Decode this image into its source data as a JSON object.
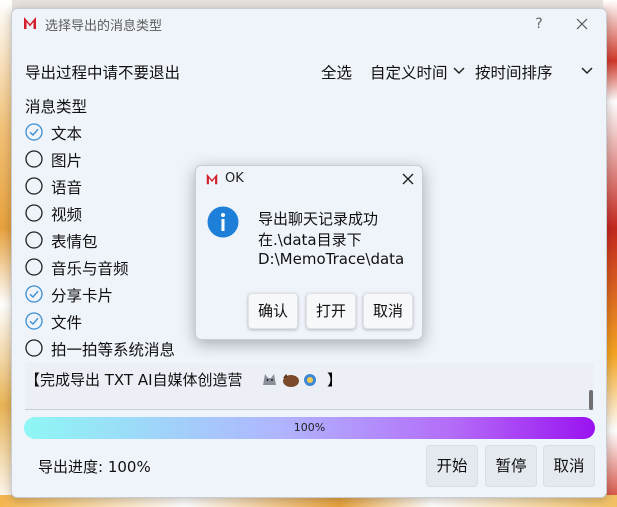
{
  "window": {
    "title": "选择导出的消息类型",
    "help_glyph": "?",
    "logo_letter": "M",
    "logo_color": "#d21f2a"
  },
  "header": {
    "notice": "导出过程中请不要退出",
    "select_all": "全选",
    "custom_time": "自定义时间",
    "sort_by_time": "按时间排序"
  },
  "message_types": {
    "label": "消息类型",
    "items": [
      {
        "label": "文本",
        "checked": true
      },
      {
        "label": "图片",
        "checked": false
      },
      {
        "label": "语音",
        "checked": false
      },
      {
        "label": "视频",
        "checked": false
      },
      {
        "label": "表情包",
        "checked": false
      },
      {
        "label": "音乐与音频",
        "checked": false
      },
      {
        "label": "分享卡片",
        "checked": true
      },
      {
        "label": "文件",
        "checked": true
      },
      {
        "label": "拍一拍等系统消息",
        "checked": false
      }
    ]
  },
  "log": {
    "text": "【完成导出 TXT AI自媒体创造营",
    "close_bracket": "】",
    "icons": [
      "wolf-emoji",
      "boar-emoji",
      "blowfish-emoji"
    ]
  },
  "progress": {
    "value": 1.0,
    "label": "100%"
  },
  "footer": {
    "status": "导出进度: 100%",
    "start_label": "开始",
    "pause_label": "暂停",
    "cancel_label": "取消"
  },
  "dialog": {
    "title": "OK",
    "message_lines": [
      "导出聊天记录成功",
      "在.\\data目录下",
      "D:\\MemoTrace\\data"
    ],
    "confirm_label": "确认",
    "open_label": "打开",
    "cancel_label": "取消",
    "info_icon_color": "#1e7fd8"
  },
  "colors": {
    "accent_check": "#3b8fd1",
    "window_bg": "#eff3fa"
  }
}
